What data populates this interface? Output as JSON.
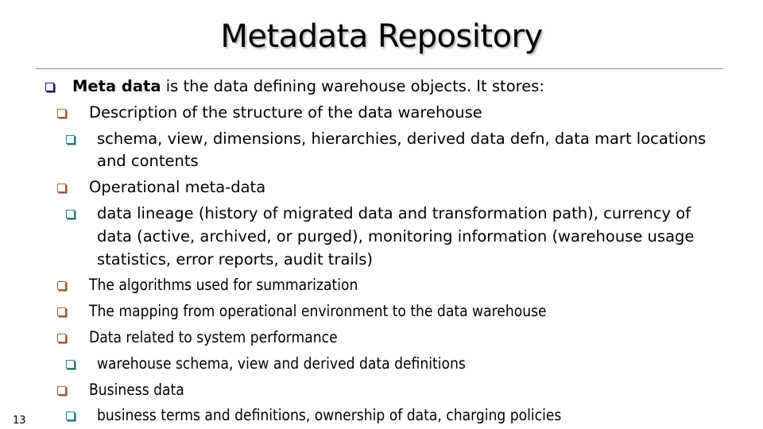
{
  "slide": {
    "title": "Metadata Repository",
    "page_number": "13",
    "bullet_colors": {
      "level1": "#1a1a8c",
      "level2": "#b0673f",
      "level3": "#2b8c80"
    },
    "items": [
      {
        "level": 1,
        "bold": "Meta data",
        "text": " is the data defining warehouse objects.  It stores:"
      },
      {
        "level": 2,
        "text": "Description of the structure of the data warehouse"
      },
      {
        "level": 3,
        "lines": [
          "schema, view, dimensions, hierarchies, derived data defn, data mart locations",
          "and contents"
        ]
      },
      {
        "level": 2,
        "text": "Operational meta-data"
      },
      {
        "level": 3,
        "lines": [
          "data lineage (history of migrated data and transformation path), currency of",
          "data (active, archived, or purged), monitoring information (warehouse usage",
          "statistics, error reports, audit trails)"
        ]
      },
      {
        "level": 2,
        "text": "The algorithms used for summarization"
      },
      {
        "level": 2,
        "text": "The mapping from operational environment to the data warehouse"
      },
      {
        "level": 2,
        "text": "Data related to system performance"
      },
      {
        "level": 3,
        "text": "warehouse schema, view and derived data definitions"
      },
      {
        "level": 2,
        "text": "Business data"
      },
      {
        "level": 3,
        "text": "business terms and definitions, ownership of data, charging policies"
      }
    ]
  }
}
